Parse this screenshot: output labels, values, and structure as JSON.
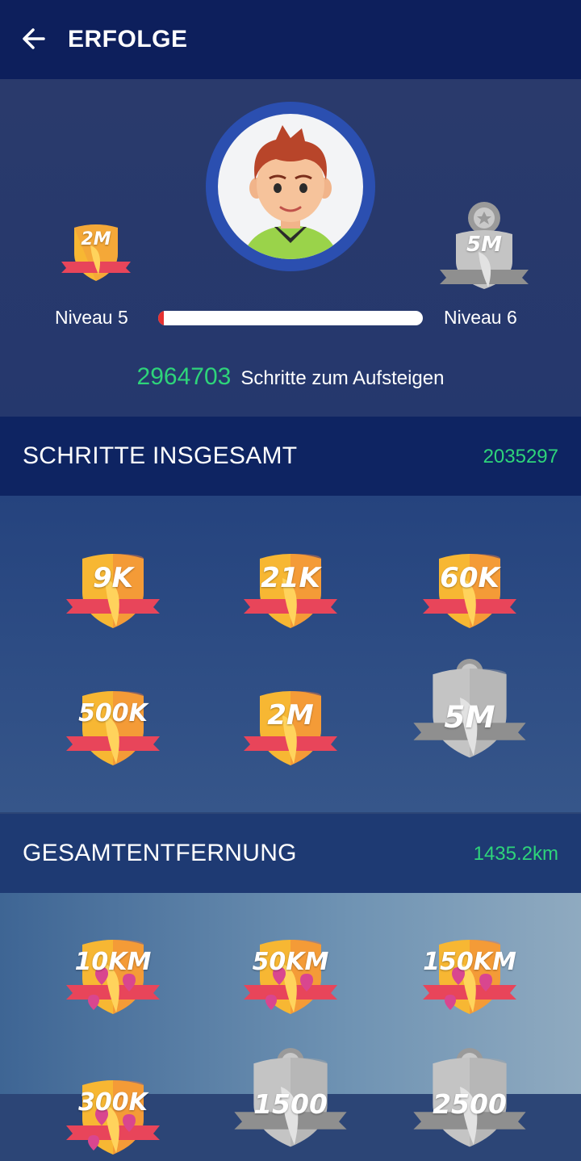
{
  "header": {
    "title": "ERFOLGE",
    "back_icon": "arrow-left-icon"
  },
  "profile": {
    "current_level": "Niveau 5",
    "next_level": "Niveau 6",
    "current_badge": "2M",
    "next_badge": "5M",
    "progress": 0.02,
    "steps_to_level": "2964703",
    "steps_to_level_text": "Schritte zum Aufsteigen"
  },
  "steps_section": {
    "title": "SCHRITTE INSGESAMT",
    "value": "2035297",
    "badges": [
      {
        "label": "9K",
        "earned": true
      },
      {
        "label": "21K",
        "earned": true
      },
      {
        "label": "60K",
        "earned": true
      },
      {
        "label": "500K",
        "earned": true
      },
      {
        "label": "2M",
        "earned": true
      },
      {
        "label": "5M",
        "earned": false
      }
    ]
  },
  "distance_section": {
    "title": "GESAMTENTFERNUNG",
    "value": "1435.2km",
    "badges": [
      {
        "label": "10KM",
        "earned": true
      },
      {
        "label": "50KM",
        "earned": true
      },
      {
        "label": "150KM",
        "earned": true
      },
      {
        "label": "300K",
        "earned": true
      },
      {
        "label": "1500",
        "earned": false
      },
      {
        "label": "2500",
        "earned": false
      }
    ]
  },
  "colors": {
    "accent_green": "#2ed47a",
    "header_bg": "#0d1f5c",
    "badge_gold": "#f7b733",
    "badge_red": "#e8455a",
    "badge_silver": "#a9a9a9"
  }
}
